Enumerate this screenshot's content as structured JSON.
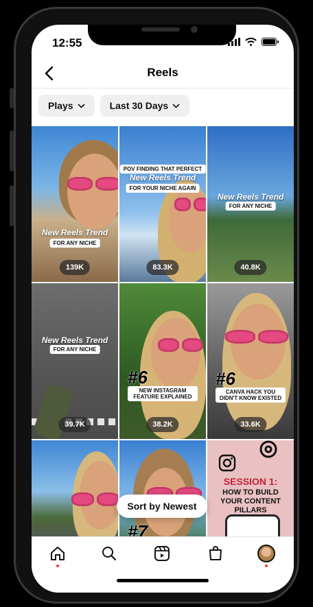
{
  "status": {
    "time": "12:55"
  },
  "header": {
    "title": "Reels"
  },
  "filters": [
    {
      "label": "Plays"
    },
    {
      "label": "Last 30 Days"
    }
  ],
  "reels": [
    {
      "plays": "139K",
      "caption_big": "New Reels Trend",
      "caption_small": "FOR ANY NICHE"
    },
    {
      "plays": "83.3K",
      "caption_top": "POV FINDING THAT PERFECT",
      "caption_big": "New Reels Trend",
      "caption_small": "FOR YOUR NICHE AGAIN"
    },
    {
      "plays": "40.8K",
      "caption_big": "New Reels Trend",
      "caption_small": "FOR ANY NICHE"
    },
    {
      "plays": "39.7K",
      "caption_big": "New Reels Trend",
      "caption_small": "FOR ANY NICHE"
    },
    {
      "plays": "38.2K",
      "number": "#6",
      "caption_small": "NEW INSTAGRAM FEATURE EXPLAINED"
    },
    {
      "plays": "33.6K",
      "number": "#6",
      "caption_small": "CANVA HACK YOU DIDN'T KNOW EXISTED"
    },
    {
      "plays": ""
    },
    {
      "plays": "",
      "number": "#7"
    },
    {
      "plays": "",
      "session_title": "SESSION 1:",
      "session_sub": "HOW TO BUILD YOUR CONTENT PILLARS"
    }
  ],
  "sort": {
    "label": "Sort by Newest"
  },
  "colors": {
    "accent": "#ff3040",
    "chip_bg": "#efefef"
  }
}
